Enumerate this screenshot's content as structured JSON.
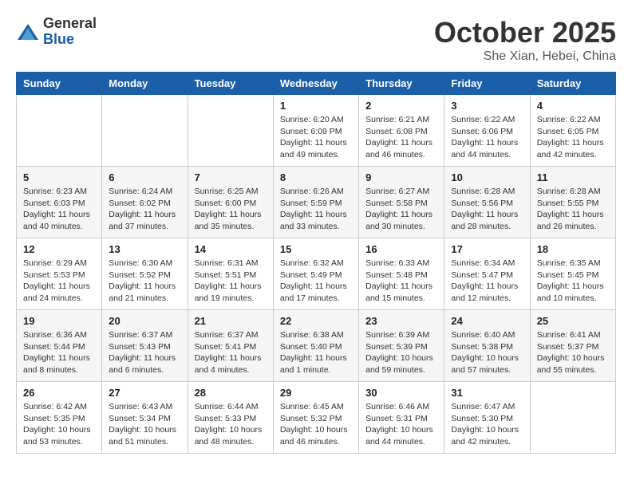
{
  "header": {
    "logo": {
      "general": "General",
      "blue": "Blue"
    },
    "title": "October 2025",
    "location": "She Xian, Hebei, China"
  },
  "weekdays": [
    "Sunday",
    "Monday",
    "Tuesday",
    "Wednesday",
    "Thursday",
    "Friday",
    "Saturday"
  ],
  "weeks": [
    [
      {
        "day": "",
        "info": ""
      },
      {
        "day": "",
        "info": ""
      },
      {
        "day": "",
        "info": ""
      },
      {
        "day": "1",
        "info": "Sunrise: 6:20 AM\nSunset: 6:09 PM\nDaylight: 11 hours\nand 49 minutes."
      },
      {
        "day": "2",
        "info": "Sunrise: 6:21 AM\nSunset: 6:08 PM\nDaylight: 11 hours\nand 46 minutes."
      },
      {
        "day": "3",
        "info": "Sunrise: 6:22 AM\nSunset: 6:06 PM\nDaylight: 11 hours\nand 44 minutes."
      },
      {
        "day": "4",
        "info": "Sunrise: 6:22 AM\nSunset: 6:05 PM\nDaylight: 11 hours\nand 42 minutes."
      }
    ],
    [
      {
        "day": "5",
        "info": "Sunrise: 6:23 AM\nSunset: 6:03 PM\nDaylight: 11 hours\nand 40 minutes."
      },
      {
        "day": "6",
        "info": "Sunrise: 6:24 AM\nSunset: 6:02 PM\nDaylight: 11 hours\nand 37 minutes."
      },
      {
        "day": "7",
        "info": "Sunrise: 6:25 AM\nSunset: 6:00 PM\nDaylight: 11 hours\nand 35 minutes."
      },
      {
        "day": "8",
        "info": "Sunrise: 6:26 AM\nSunset: 5:59 PM\nDaylight: 11 hours\nand 33 minutes."
      },
      {
        "day": "9",
        "info": "Sunrise: 6:27 AM\nSunset: 5:58 PM\nDaylight: 11 hours\nand 30 minutes."
      },
      {
        "day": "10",
        "info": "Sunrise: 6:28 AM\nSunset: 5:56 PM\nDaylight: 11 hours\nand 28 minutes."
      },
      {
        "day": "11",
        "info": "Sunrise: 6:28 AM\nSunset: 5:55 PM\nDaylight: 11 hours\nand 26 minutes."
      }
    ],
    [
      {
        "day": "12",
        "info": "Sunrise: 6:29 AM\nSunset: 5:53 PM\nDaylight: 11 hours\nand 24 minutes."
      },
      {
        "day": "13",
        "info": "Sunrise: 6:30 AM\nSunset: 5:52 PM\nDaylight: 11 hours\nand 21 minutes."
      },
      {
        "day": "14",
        "info": "Sunrise: 6:31 AM\nSunset: 5:51 PM\nDaylight: 11 hours\nand 19 minutes."
      },
      {
        "day": "15",
        "info": "Sunrise: 6:32 AM\nSunset: 5:49 PM\nDaylight: 11 hours\nand 17 minutes."
      },
      {
        "day": "16",
        "info": "Sunrise: 6:33 AM\nSunset: 5:48 PM\nDaylight: 11 hours\nand 15 minutes."
      },
      {
        "day": "17",
        "info": "Sunrise: 6:34 AM\nSunset: 5:47 PM\nDaylight: 11 hours\nand 12 minutes."
      },
      {
        "day": "18",
        "info": "Sunrise: 6:35 AM\nSunset: 5:45 PM\nDaylight: 11 hours\nand 10 minutes."
      }
    ],
    [
      {
        "day": "19",
        "info": "Sunrise: 6:36 AM\nSunset: 5:44 PM\nDaylight: 11 hours\nand 8 minutes."
      },
      {
        "day": "20",
        "info": "Sunrise: 6:37 AM\nSunset: 5:43 PM\nDaylight: 11 hours\nand 6 minutes."
      },
      {
        "day": "21",
        "info": "Sunrise: 6:37 AM\nSunset: 5:41 PM\nDaylight: 11 hours\nand 4 minutes."
      },
      {
        "day": "22",
        "info": "Sunrise: 6:38 AM\nSunset: 5:40 PM\nDaylight: 11 hours\nand 1 minute."
      },
      {
        "day": "23",
        "info": "Sunrise: 6:39 AM\nSunset: 5:39 PM\nDaylight: 10 hours\nand 59 minutes."
      },
      {
        "day": "24",
        "info": "Sunrise: 6:40 AM\nSunset: 5:38 PM\nDaylight: 10 hours\nand 57 minutes."
      },
      {
        "day": "25",
        "info": "Sunrise: 6:41 AM\nSunset: 5:37 PM\nDaylight: 10 hours\nand 55 minutes."
      }
    ],
    [
      {
        "day": "26",
        "info": "Sunrise: 6:42 AM\nSunset: 5:35 PM\nDaylight: 10 hours\nand 53 minutes."
      },
      {
        "day": "27",
        "info": "Sunrise: 6:43 AM\nSunset: 5:34 PM\nDaylight: 10 hours\nand 51 minutes."
      },
      {
        "day": "28",
        "info": "Sunrise: 6:44 AM\nSunset: 5:33 PM\nDaylight: 10 hours\nand 48 minutes."
      },
      {
        "day": "29",
        "info": "Sunrise: 6:45 AM\nSunset: 5:32 PM\nDaylight: 10 hours\nand 46 minutes."
      },
      {
        "day": "30",
        "info": "Sunrise: 6:46 AM\nSunset: 5:31 PM\nDaylight: 10 hours\nand 44 minutes."
      },
      {
        "day": "31",
        "info": "Sunrise: 6:47 AM\nSunset: 5:30 PM\nDaylight: 10 hours\nand 42 minutes."
      },
      {
        "day": "",
        "info": ""
      }
    ]
  ]
}
